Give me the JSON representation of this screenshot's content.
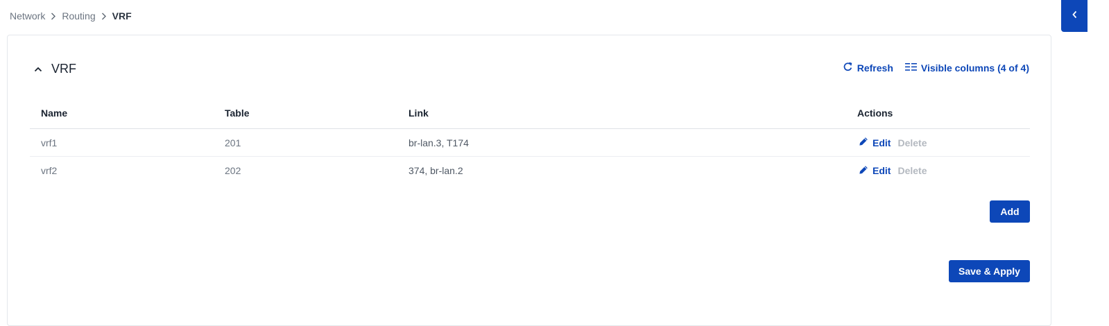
{
  "breadcrumb": {
    "items": [
      "Network",
      "Routing"
    ],
    "current": "VRF"
  },
  "section": {
    "title": "VRF",
    "refresh_label": "Refresh",
    "columns_label": "Visible columns (4 of 4)"
  },
  "table": {
    "headers": {
      "name": "Name",
      "table": "Table",
      "link": "Link",
      "actions": "Actions"
    },
    "rows": [
      {
        "name": "vrf1",
        "table": "201",
        "link": "br-lan.3, T174",
        "edit": "Edit",
        "delete": "Delete"
      },
      {
        "name": "vrf2",
        "table": "202",
        "link": "374, br-lan.2",
        "edit": "Edit",
        "delete": "Delete"
      }
    ]
  },
  "buttons": {
    "add": "Add",
    "save_apply": "Save & Apply"
  },
  "colors": {
    "accent": "#0d47b8",
    "muted_text": "#6b7480",
    "disabled": "#b4b9c0"
  },
  "icons": {
    "breadcrumb_separator": "chevron-right-icon",
    "collapse": "chevron-up-icon",
    "refresh": "refresh-icon",
    "columns": "columns-list-icon",
    "edit": "pencil-icon",
    "sidebar_toggle": "chevron-left-icon"
  }
}
